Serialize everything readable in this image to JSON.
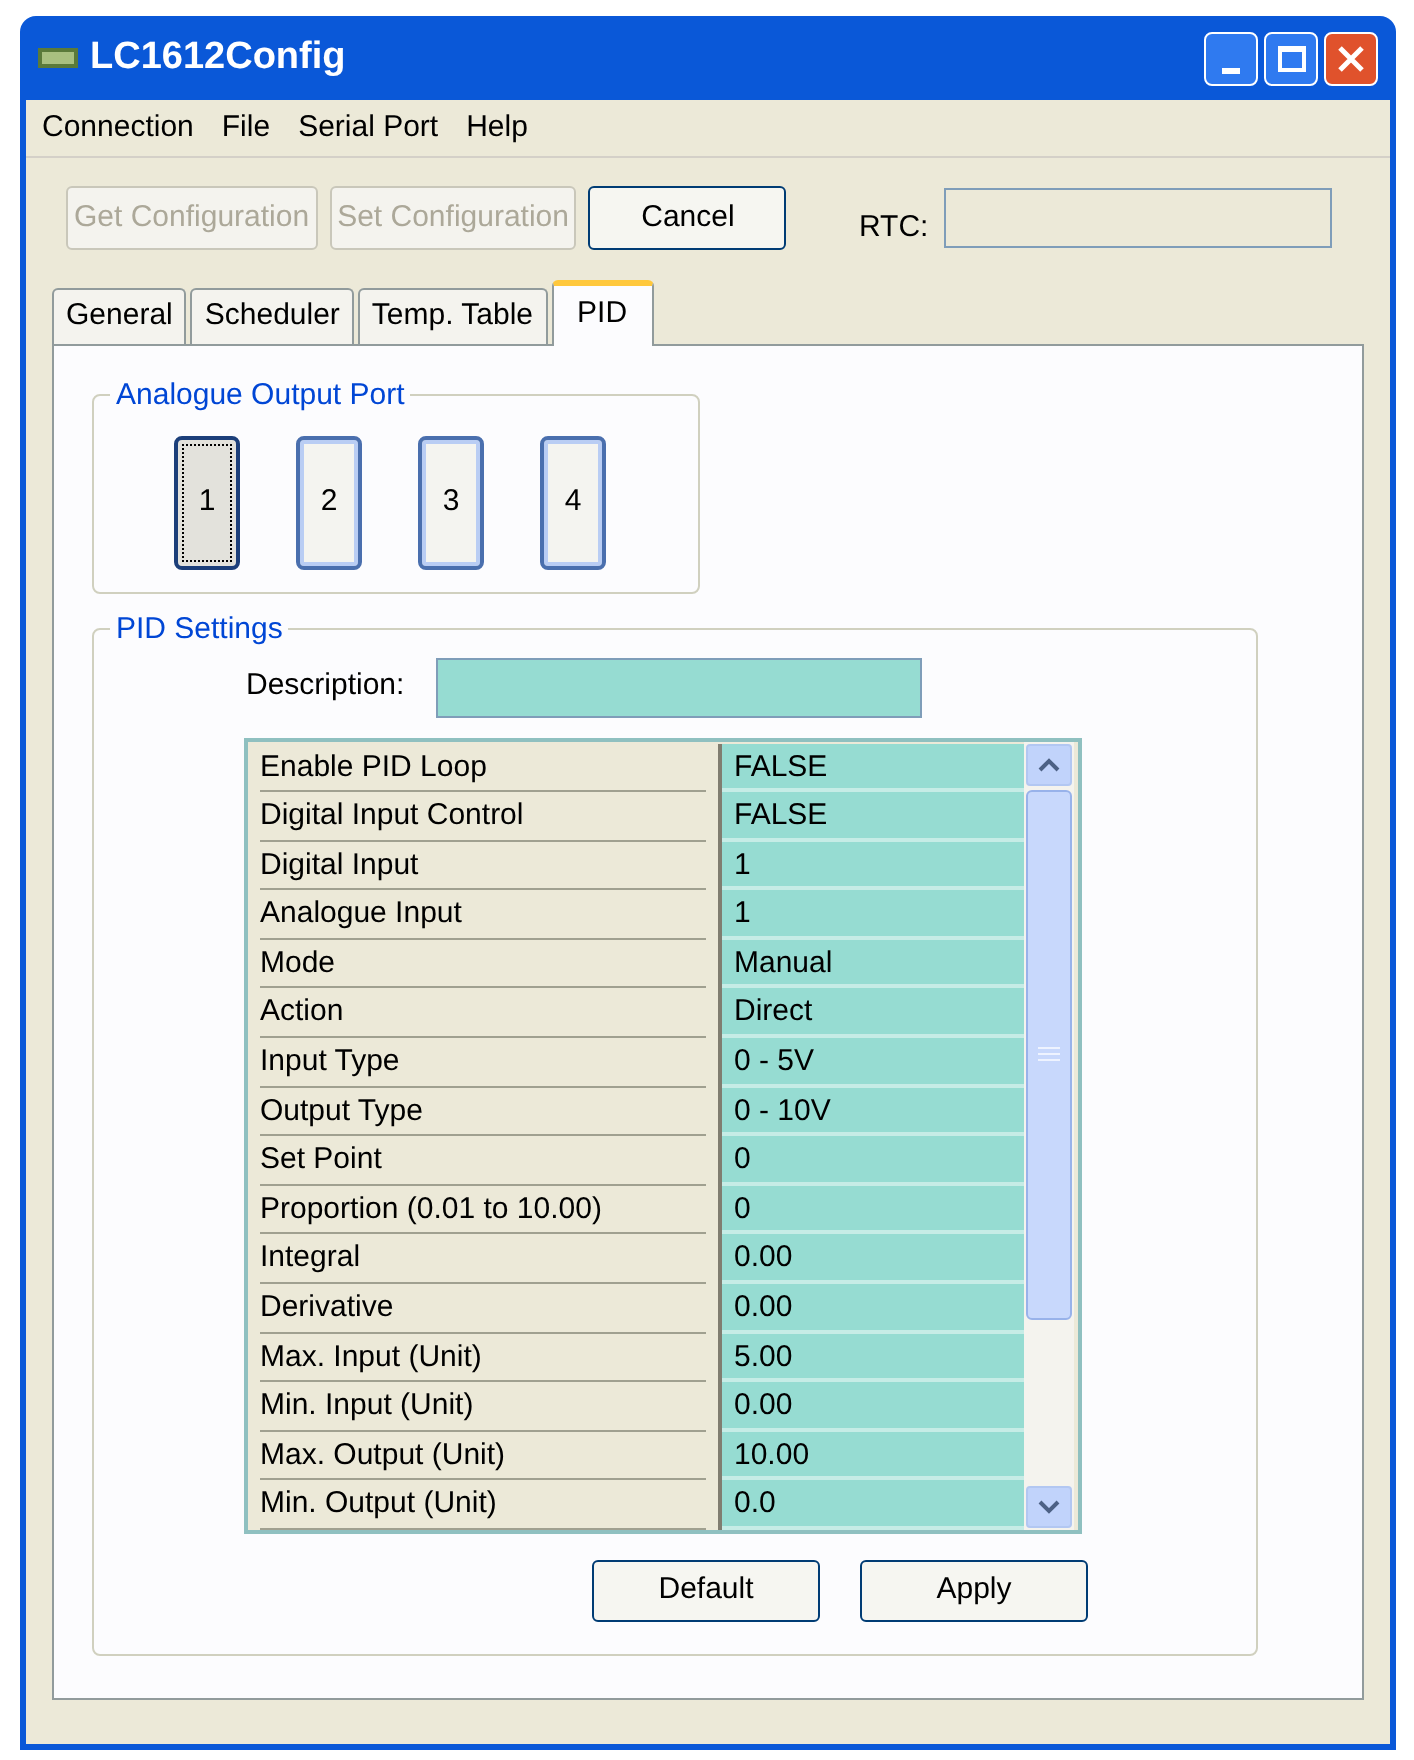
{
  "window": {
    "title": "LC1612Config"
  },
  "menu": [
    "Connection",
    "File",
    "Serial Port",
    "Help"
  ],
  "toolbar": {
    "buttons": [
      {
        "label": "Get Configuration",
        "disabled": true
      },
      {
        "label": "Set Configuration",
        "disabled": true
      },
      {
        "label": "Cancel",
        "disabled": false
      }
    ],
    "rtc": {
      "label": "RTC:"
    }
  },
  "tabs": [
    {
      "label": "General",
      "selected": false
    },
    {
      "label": "Scheduler",
      "selected": false
    },
    {
      "label": "Temp. Table",
      "selected": false
    },
    {
      "label": "PID",
      "selected": true
    }
  ],
  "output_port": {
    "title": "Analogue Output Port",
    "ports": [
      {
        "label": "1",
        "selected": true
      },
      {
        "label": "2",
        "selected": false
      },
      {
        "label": "3",
        "selected": false
      },
      {
        "label": "4",
        "selected": false
      }
    ]
  },
  "pid_settings": {
    "title": "PID Settings",
    "description_label": "Description:",
    "rows": [
      {
        "name": "Enable PID Loop",
        "value": "FALSE"
      },
      {
        "name": "Digital Input Control",
        "value": "FALSE"
      },
      {
        "name": "Digital Input",
        "value": "1"
      },
      {
        "name": "Analogue Input",
        "value": "1"
      },
      {
        "name": "Mode",
        "value": "Manual"
      },
      {
        "name": "Action",
        "value": "Direct"
      },
      {
        "name": "Input Type",
        "value": "0 - 5V"
      },
      {
        "name": "Output Type",
        "value": "0 - 10V"
      },
      {
        "name": "Set Point",
        "value": "0"
      },
      {
        "name": "Proportion (0.01 to 10.00)",
        "value": "0"
      },
      {
        "name": "Integral",
        "value": "0.00"
      },
      {
        "name": "Derivative",
        "value": "0.00"
      },
      {
        "name": "Max. Input (Unit)",
        "value": "5.00"
      },
      {
        "name": "Min. Input (Unit)",
        "value": "0.00"
      },
      {
        "name": "Max. Output (Unit)",
        "value": "10.00"
      },
      {
        "name": "Min. Output (Unit)",
        "value": "0.0"
      }
    ],
    "buttons": [
      "Default",
      "Apply"
    ]
  }
}
